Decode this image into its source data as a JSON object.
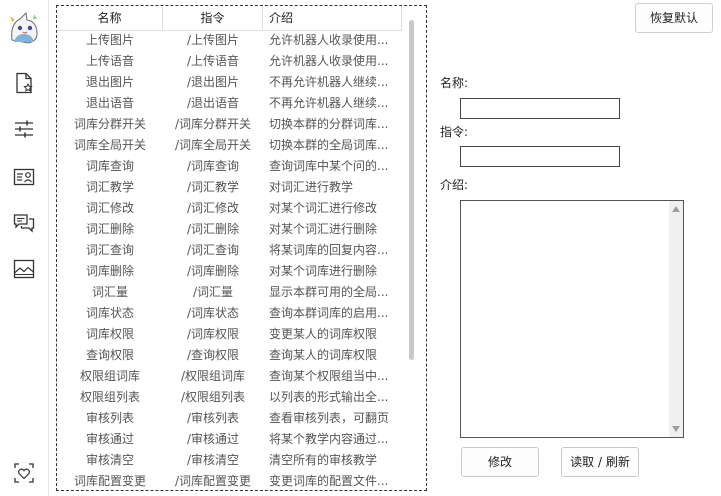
{
  "rail": {
    "items": [
      {
        "name": "file-star-icon"
      },
      {
        "name": "sliders-icon"
      },
      {
        "name": "id-card-icon"
      },
      {
        "name": "chat-bubbles-icon"
      },
      {
        "name": "image-icon"
      },
      {
        "name": "heart-scan-icon"
      }
    ]
  },
  "table": {
    "headers": [
      "名称",
      "指令",
      "介绍"
    ],
    "rows": [
      [
        "上传图片",
        "/上传图片",
        "允许机器人收录使用..."
      ],
      [
        "上传语音",
        "/上传语音",
        "允许机器人收录使用..."
      ],
      [
        "退出图片",
        "/退出图片",
        "不再允许机器人继续..."
      ],
      [
        "退出语音",
        "/退出语音",
        "不再允许机器人继续..."
      ],
      [
        "词库分群开关",
        "/词库分群开关",
        "切换本群的分群词库..."
      ],
      [
        "词库全局开关",
        "/词库全局开关",
        "切换本群的全局词库..."
      ],
      [
        "词库查询",
        "/词库查询",
        "查询词库中某个问的..."
      ],
      [
        "词汇教学",
        "/词汇教学",
        "对词汇进行教学"
      ],
      [
        "词汇修改",
        "/词汇修改",
        "对某个词汇进行修改"
      ],
      [
        "词汇删除",
        "/词汇删除",
        "对某个词汇进行删除"
      ],
      [
        "词汇查询",
        "/词汇查询",
        "将某词库的回复内容..."
      ],
      [
        "词库删除",
        "/词库删除",
        "对某个词库进行删除"
      ],
      [
        "词汇量",
        "/词汇量",
        "显示本群可用的全局..."
      ],
      [
        "词库状态",
        "/词库状态",
        "查询本群词库的启用..."
      ],
      [
        "词库权限",
        "/词库权限",
        "变更某人的词库权限"
      ],
      [
        "查询权限",
        "/查询权限",
        "查询某人的词库权限"
      ],
      [
        "权限组词库",
        "/权限组词库",
        "查询某个权限组当中..."
      ],
      [
        "权限组列表",
        "/权限组列表",
        "以列表的形式输出全..."
      ],
      [
        "审核列表",
        "/审核列表",
        "查看审核列表，可翻页"
      ],
      [
        "审核通过",
        "/审核通过",
        "将某个教学内容通过..."
      ],
      [
        "审核清空",
        "/审核清空",
        "清空所有的审核教学"
      ],
      [
        "词库配置变更",
        "/词库配置变更",
        "变更词库的配置文件..."
      ]
    ]
  },
  "panel": {
    "restore_label": "恢复默认",
    "name_label": "名称:",
    "name_value": "",
    "command_label": "指令:",
    "command_value": "",
    "intro_label": "介绍:",
    "intro_value": "",
    "modify_label": "修改",
    "reload_label": "读取 / 刷新"
  }
}
